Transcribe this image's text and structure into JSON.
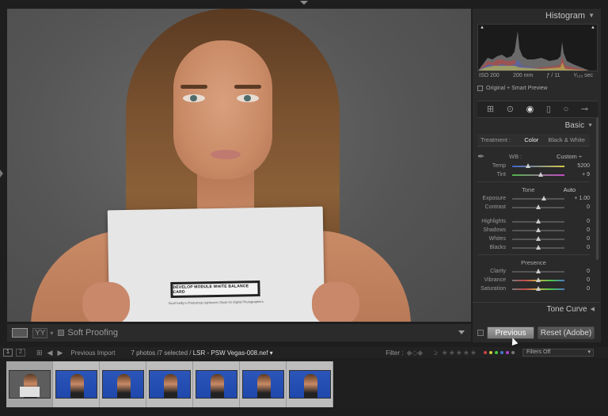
{
  "photo": {
    "card_text": "DEVELOP MODULE WHITE BALANCE CARD",
    "card_subtext": "Scott Kelby's Photoshop Lightroom | Book for Digital Photographers"
  },
  "toolbar": {
    "view_mode": "YY",
    "soft_proofing_label": "Soft Proofing"
  },
  "histogram": {
    "title": "Histogram",
    "iso": "ISO 200",
    "focal": "200 mm",
    "aperture": "ƒ / 11",
    "shutter": "¹⁄₁₂₅ sec",
    "preview_label": "Original + Smart Preview"
  },
  "basic": {
    "title": "Basic",
    "treatment_label": "Treatment :",
    "color_label": "Color",
    "bw_label": "Black & White",
    "wb_label": "WB :",
    "wb_value": "Custom ÷",
    "temp": {
      "label": "Temp",
      "value": "5200",
      "pos": 0.3
    },
    "tint": {
      "label": "Tint",
      "value": "+ 9",
      "pos": 0.55
    },
    "tone_label": "Tone",
    "auto_label": "Auto",
    "exposure": {
      "label": "Exposure",
      "value": "+ 1.00",
      "pos": 0.6
    },
    "contrast": {
      "label": "Contrast",
      "value": "0",
      "pos": 0.5
    },
    "highlights": {
      "label": "Highlights",
      "value": "0",
      "pos": 0.5
    },
    "shadows": {
      "label": "Shadows",
      "value": "0",
      "pos": 0.5
    },
    "whites": {
      "label": "Whites",
      "value": "0",
      "pos": 0.5
    },
    "blacks": {
      "label": "Blacks",
      "value": "0",
      "pos": 0.5
    },
    "presence_label": "Presence",
    "clarity": {
      "label": "Clarity",
      "value": "0",
      "pos": 0.5
    },
    "vibrance": {
      "label": "Vibrance",
      "value": "0",
      "pos": 0.5
    },
    "saturation": {
      "label": "Saturation",
      "value": "0",
      "pos": 0.5
    }
  },
  "tone_curve_label": "Tone Curve",
  "buttons": {
    "previous": "Previous",
    "reset": "Reset (Adobe)"
  },
  "filmstrip_bar": {
    "monitor1": "1",
    "monitor2": "2",
    "source": "Previous Import",
    "info_prefix": "7 photos /7 selected /",
    "info_file": "LSR - PSW Vegas-008.nef ▾",
    "filter_label": "Filter :",
    "filters_off": "Filters Off"
  },
  "filmstrip": {
    "count": 7
  },
  "colors": {
    "accent_button": "#8f8f8f",
    "panel_bg": "#2a2a2a",
    "photo_bg": "#5c5c5c",
    "thumb_blue": "#2c55b8"
  }
}
